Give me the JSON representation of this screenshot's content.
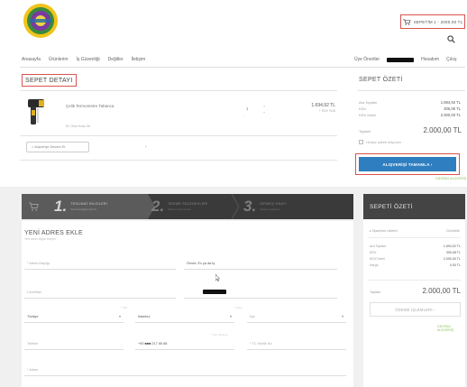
{
  "header": {
    "cart_label": "SEPETİM 1 - 2000,00 TL",
    "nav": [
      "Anasayfa",
      "Ürünlerim",
      "İş Güvenliği",
      "Değiller",
      "İletişim"
    ],
    "nav_right": {
      "account": "Üye Öneriler",
      "logout": "Hesabım",
      "exit": "Çıkış"
    }
  },
  "cart": {
    "title": "SEPET DETAYI",
    "product": {
      "name": "Çelik Termometre Tabanca",
      "sub": "ID: Ürün Kodu 95",
      "qty": "1",
      "qty_minus": "-",
      "stepper_up": "+",
      "stepper_down": "+",
      "price": "1.694,92 TL",
      "kdv": "+ KDV %18"
    },
    "continue_label": "< Alışverişe Devam Et",
    "continue_chevron": "›"
  },
  "summary1": {
    "title": "SEPET ÖZETİ",
    "rows": [
      {
        "label": "Ara Toplam",
        "value": "1.694,92 TL"
      },
      {
        "label": "KDV",
        "value": "305,08 TL"
      },
      {
        "label": "KDV Dahil",
        "value": "2.000,00 TL"
      }
    ],
    "total_label": "Toplam",
    "total_value": "2.000,00 TL",
    "checkbox_label": "Hediye paketi istiyorum",
    "checkout_label": "ALIŞVERİŞİ TAMAMLA  ›",
    "secure": "GÜVENLİ ALIŞVERİŞ"
  },
  "steps": [
    {
      "num": "1.",
      "t1": "TESLİMAT BİLGİLERİ",
      "t2": "Teslimat bilgileri giriniz"
    },
    {
      "num": "2.",
      "t1": "ÖDEME SEÇENEKLERİ",
      "t2": "Ödeme tipini seçiniz"
    },
    {
      "num": "3.",
      "t1": "SİPARİŞ ONAYI",
      "t2": "Sipariş onaylama"
    }
  ],
  "form": {
    "title": "YENİ ADRES EKLE",
    "subtitle": "Yeni adres bilgisi ekleyin.",
    "address_title": "* Adres Başlığı",
    "address_title_value": "Örnek: Ev ya da İş",
    "name_label": "Cemilhan",
    "country": "Türkiye",
    "city": "İstanbul",
    "district": "İlçe",
    "phone_label": "Telefon",
    "phone_value": "+90 ■■■ 217 65 68",
    "tc_label": "* TC Kimlik No",
    "address_label": "* Adres",
    "dropdown_icon": "▾",
    "mini_labels": {
      "country": "* Ülke",
      "city": "* Şehir",
      "phone": "* Cep Telefonu"
    }
  },
  "summary2": {
    "title": "SEPETİ ÖZETİ",
    "line_left": "▸ Siparişiniz Listeleri",
    "line_right": "Görüntüle",
    "rows": [
      {
        "label": "Ara Toplam",
        "value": "1.694,92 TL"
      },
      {
        "label": "KDV",
        "value": "305,08 TL"
      },
      {
        "label": "KDV Dahil",
        "value": "2.000,00 TL"
      },
      {
        "label": "Kargo",
        "value": "0,00 TL"
      }
    ],
    "total_label": "Toplam",
    "total_value": "2.000,00 TL",
    "button_label": "ÖDEME İŞLEMLERİ  ›",
    "secure": "GÜVENLİ ALIŞVERİŞ"
  },
  "colors": {
    "highlight": "#d9534f",
    "checkout_blue": "#2f7fc0",
    "steps_dark": "#3a3a3a",
    "logo_ring": "#f0c419",
    "logo_center": "#7a3aa0"
  },
  "icons": [
    "logo",
    "cart-icon",
    "search-icon",
    "cursor-icon",
    "shopping-cart-icon"
  ]
}
